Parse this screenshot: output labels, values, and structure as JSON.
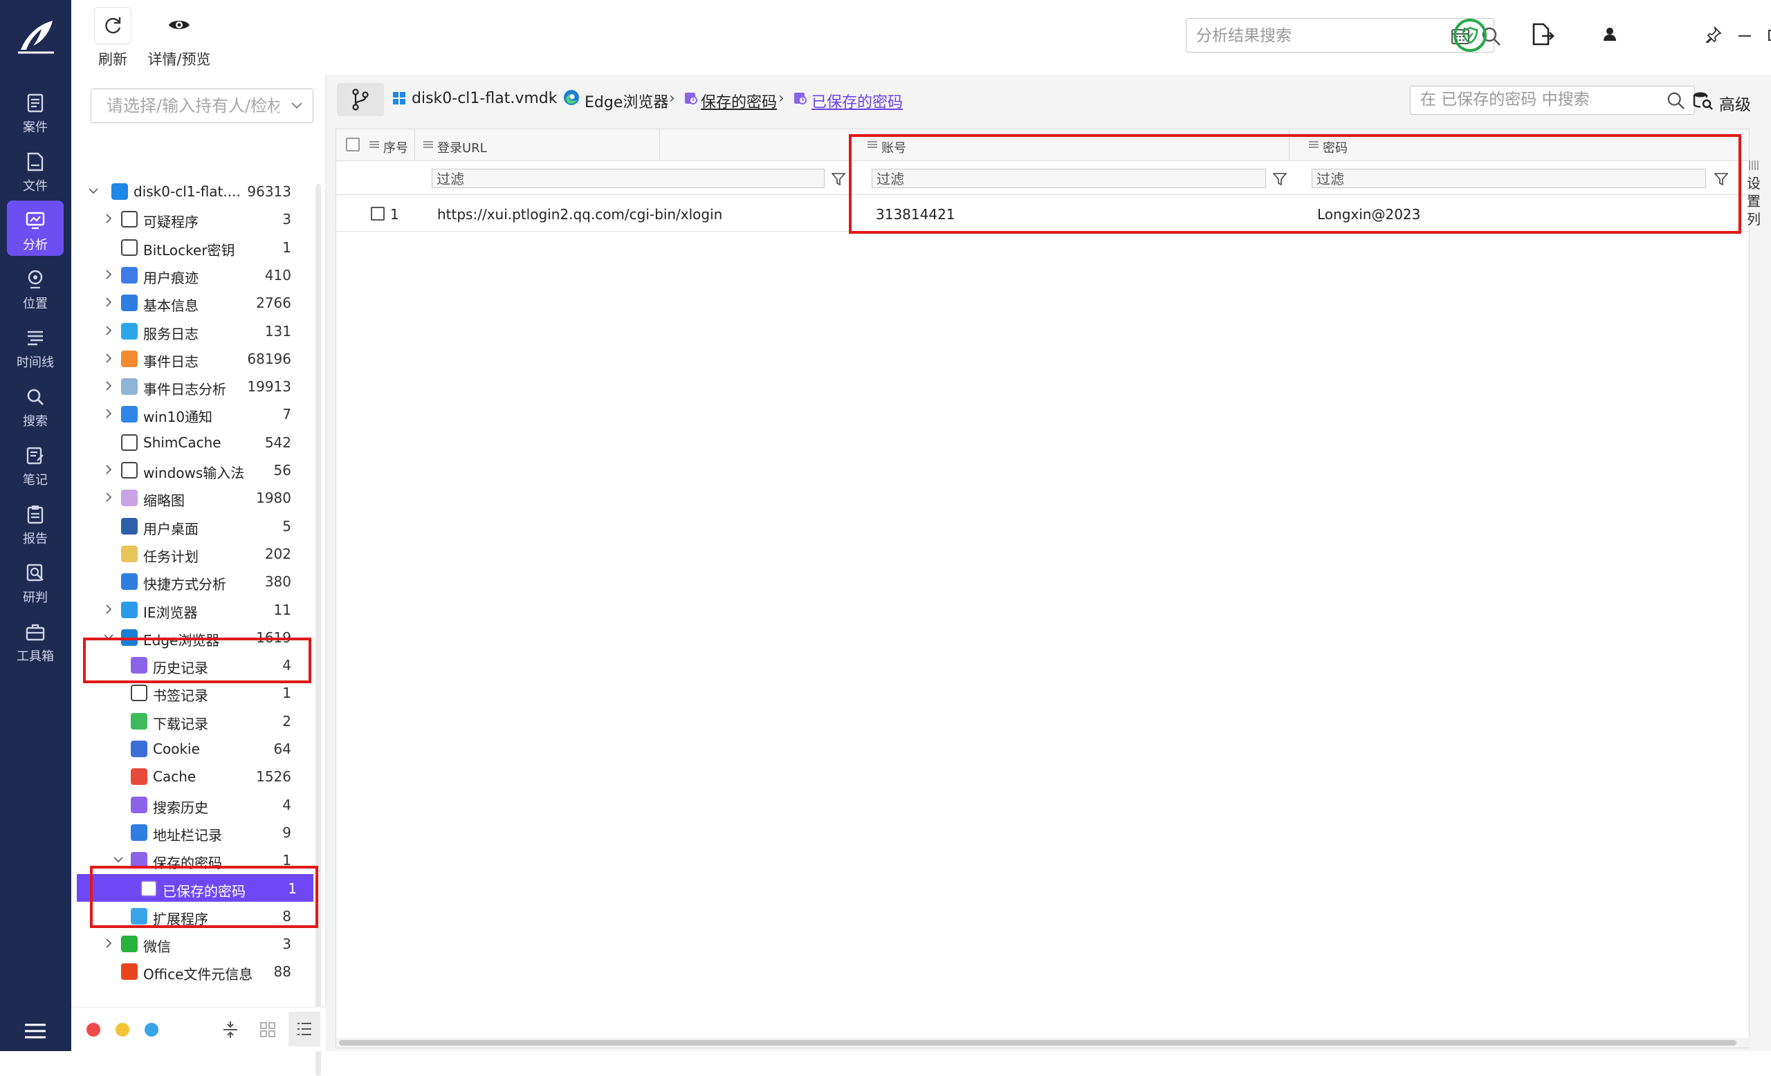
{
  "toolbar": {
    "refresh_label": "刷新",
    "details_label": "详情/预览",
    "search_placeholder": "分析结果搜索"
  },
  "nav": [
    {
      "label": "案件",
      "icon": "case-icon"
    },
    {
      "label": "文件",
      "icon": "file-icon"
    },
    {
      "label": "分析",
      "icon": "analysis-icon",
      "active": true
    },
    {
      "label": "位置",
      "icon": "location-icon"
    },
    {
      "label": "时间线",
      "icon": "timeline-icon"
    },
    {
      "label": "搜索",
      "icon": "search-icon"
    },
    {
      "label": "笔记",
      "icon": "note-icon"
    },
    {
      "label": "报告",
      "icon": "report-icon"
    },
    {
      "label": "研判",
      "icon": "judge-icon"
    },
    {
      "label": "工具箱",
      "icon": "toolbox-icon"
    }
  ],
  "tree": {
    "holder_placeholder": "请选择/输入持有人/检材",
    "items": [
      {
        "label": "disk0-cl1-flat....",
        "count": "96313",
        "icon": "windows-icon",
        "toggle": "down"
      },
      {
        "label": "可疑程序",
        "count": "3",
        "icon": "suspicious-icon",
        "toggle": "right"
      },
      {
        "label": "BitLocker密钥",
        "count": "1",
        "icon": "key-search-icon",
        "toggle": ""
      },
      {
        "label": "用户痕迹",
        "count": "410",
        "icon": "footprint-icon",
        "toggle": "right"
      },
      {
        "label": "基本信息",
        "count": "2766",
        "icon": "info-list-icon",
        "toggle": "right"
      },
      {
        "label": "服务日志",
        "count": "131",
        "icon": "service-icon",
        "toggle": "right"
      },
      {
        "label": "事件日志",
        "count": "68196",
        "icon": "event-log-icon",
        "toggle": "right"
      },
      {
        "label": "事件日志分析",
        "count": "19913",
        "icon": "event-analysis-icon",
        "toggle": "right"
      },
      {
        "label": "win10通知",
        "count": "7",
        "icon": "bell-icon",
        "toggle": "right"
      },
      {
        "label": "ShimCache",
        "count": "542",
        "icon": "cloud-icon",
        "toggle": ""
      },
      {
        "label": "windows输入法",
        "count": "56",
        "icon": "keyboard-icon",
        "toggle": "right"
      },
      {
        "label": "缩略图",
        "count": "1980",
        "icon": "thumbnail-icon",
        "toggle": "right"
      },
      {
        "label": "用户桌面",
        "count": "5",
        "icon": "desktop-icon",
        "toggle": ""
      },
      {
        "label": "任务计划",
        "count": "202",
        "icon": "clock-icon",
        "toggle": ""
      },
      {
        "label": "快捷方式分析",
        "count": "380",
        "icon": "shortcut-icon",
        "toggle": ""
      },
      {
        "label": "IE浏览器",
        "count": "11",
        "icon": "ie-icon",
        "toggle": "right"
      },
      {
        "label": "Edge浏览器",
        "count": "1619",
        "icon": "edge-icon",
        "toggle": "down"
      },
      {
        "label": "历史记录",
        "count": "4",
        "icon": "history-icon",
        "toggle": "",
        "level": 2
      },
      {
        "label": "书签记录",
        "count": "1",
        "icon": "bookmark-icon",
        "toggle": "",
        "level": 2
      },
      {
        "label": "下载记录",
        "count": "2",
        "icon": "download-icon",
        "toggle": "",
        "level": 2
      },
      {
        "label": "Cookie",
        "count": "64",
        "icon": "cookie-icon",
        "toggle": "",
        "level": 2
      },
      {
        "label": "Cache",
        "count": "1526",
        "icon": "cache-icon",
        "toggle": "",
        "level": 2
      },
      {
        "label": "搜索历史",
        "count": "4",
        "icon": "search-history-icon",
        "toggle": "",
        "level": 2
      },
      {
        "label": "地址栏记录",
        "count": "9",
        "icon": "address-bar-icon",
        "toggle": "",
        "level": 2
      },
      {
        "label": "保存的密码",
        "count": "1",
        "icon": "password-icon",
        "toggle": "down",
        "level": 2
      },
      {
        "label": "已保存的密码",
        "count": "1",
        "icon": "password-icon",
        "toggle": "",
        "level": 3,
        "selected": true
      },
      {
        "label": "扩展程序",
        "count": "8",
        "icon": "extension-icon",
        "toggle": "",
        "level": 2
      },
      {
        "label": "微信",
        "count": "3",
        "icon": "wechat-icon",
        "toggle": "right"
      },
      {
        "label": "Office文件元信息",
        "count": "88",
        "icon": "office-icon",
        "toggle": ""
      }
    ]
  },
  "breadcrumb": {
    "disk": "disk0-cl1-flat.vmdk",
    "browser": "Edge浏览器",
    "category": "保存的密码",
    "current": "已保存的密码"
  },
  "list_search": {
    "placeholder": "在 已保存的密码 中搜索",
    "advanced_label": "高级"
  },
  "table": {
    "columns": [
      "序号",
      "登录URL",
      "账号",
      "密码"
    ],
    "filter_placeholder": "过滤",
    "rows": [
      {
        "index": "1",
        "url": "https://xui.ptlogin2.qq.com/cgi-bin/xlogin",
        "account": "313814421",
        "password": "Longxin@2023"
      }
    ],
    "settings_label": [
      "设",
      "置",
      "列"
    ]
  },
  "colors": {
    "rail_bg": "#1d2a52",
    "accent": "#6b4ff3",
    "highlight_box": "#e01919",
    "status_dots": [
      "#ef4b4b",
      "#f6c238",
      "#3aa4e8"
    ]
  }
}
